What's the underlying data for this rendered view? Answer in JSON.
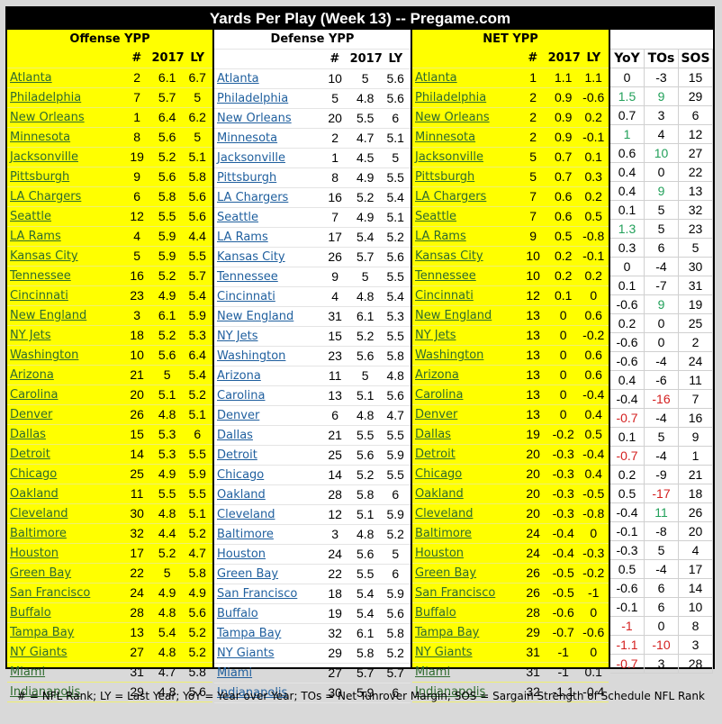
{
  "title": "Yards Per Play (Week 13) -- Pregame.com",
  "sections": {
    "offense": {
      "title": "Offense YPP",
      "cols": [
        "#",
        "2017",
        "LY"
      ]
    },
    "defense": {
      "title": "Defense YPP",
      "cols": [
        "#",
        "2017",
        "LY"
      ]
    },
    "net": {
      "title": "NET YPP",
      "cols": [
        "#",
        "2017",
        "LY"
      ]
    },
    "extra": {
      "cols": [
        "YoY",
        "TOs",
        "SOS"
      ]
    }
  },
  "colors": {
    "highlight": "#ffff00",
    "positive": "#22a05a",
    "negative": "#d42020"
  },
  "offense": [
    [
      "Atlanta",
      "2",
      "6.1",
      "6.7"
    ],
    [
      "Philadelphia",
      "7",
      "5.7",
      "5"
    ],
    [
      "New Orleans",
      "1",
      "6.4",
      "6.2"
    ],
    [
      "Minnesota",
      "8",
      "5.6",
      "5"
    ],
    [
      "Jacksonville",
      "19",
      "5.2",
      "5.1"
    ],
    [
      "Pittsburgh",
      "9",
      "5.6",
      "5.8"
    ],
    [
      "LA Chargers",
      "6",
      "5.8",
      "5.6"
    ],
    [
      "Seattle",
      "12",
      "5.5",
      "5.6"
    ],
    [
      "LA Rams",
      "4",
      "5.9",
      "4.4"
    ],
    [
      "Kansas City",
      "5",
      "5.9",
      "5.5"
    ],
    [
      "Tennessee",
      "16",
      "5.2",
      "5.7"
    ],
    [
      "Cincinnati",
      "23",
      "4.9",
      "5.4"
    ],
    [
      "New England",
      "3",
      "6.1",
      "5.9"
    ],
    [
      "NY Jets",
      "18",
      "5.2",
      "5.3"
    ],
    [
      "Washington",
      "10",
      "5.6",
      "6.4"
    ],
    [
      "Arizona",
      "21",
      "5",
      "5.4"
    ],
    [
      "Carolina",
      "20",
      "5.1",
      "5.2"
    ],
    [
      "Denver",
      "26",
      "4.8",
      "5.1"
    ],
    [
      "Dallas",
      "15",
      "5.3",
      "6"
    ],
    [
      "Detroit",
      "14",
      "5.3",
      "5.5"
    ],
    [
      "Chicago",
      "25",
      "4.9",
      "5.9"
    ],
    [
      "Oakland",
      "11",
      "5.5",
      "5.5"
    ],
    [
      "Cleveland",
      "30",
      "4.8",
      "5.1"
    ],
    [
      "Baltimore",
      "32",
      "4.4",
      "5.2"
    ],
    [
      "Houston",
      "17",
      "5.2",
      "4.7"
    ],
    [
      "Green Bay",
      "22",
      "5",
      "5.8"
    ],
    [
      "San Francisco",
      "24",
      "4.9",
      "4.9"
    ],
    [
      "Buffalo",
      "28",
      "4.8",
      "5.6"
    ],
    [
      "Tampa Bay",
      "13",
      "5.4",
      "5.2"
    ],
    [
      "NY Giants",
      "27",
      "4.8",
      "5.2"
    ],
    [
      "Miami",
      "31",
      "4.7",
      "5.8"
    ],
    [
      "Indianapolis",
      "29",
      "4.8",
      "5.6"
    ]
  ],
  "defense": [
    [
      "Atlanta",
      "10",
      "5",
      "5.6"
    ],
    [
      "Philadelphia",
      "5",
      "4.8",
      "5.6"
    ],
    [
      "New Orleans",
      "20",
      "5.5",
      "6"
    ],
    [
      "Minnesota",
      "2",
      "4.7",
      "5.1"
    ],
    [
      "Jacksonville",
      "1",
      "4.5",
      "5"
    ],
    [
      "Pittsburgh",
      "8",
      "4.9",
      "5.5"
    ],
    [
      "LA Chargers",
      "16",
      "5.2",
      "5.4"
    ],
    [
      "Seattle",
      "7",
      "4.9",
      "5.1"
    ],
    [
      "LA Rams",
      "17",
      "5.4",
      "5.2"
    ],
    [
      "Kansas City",
      "26",
      "5.7",
      "5.6"
    ],
    [
      "Tennessee",
      "9",
      "5",
      "5.5"
    ],
    [
      "Cincinnati",
      "4",
      "4.8",
      "5.4"
    ],
    [
      "New England",
      "31",
      "6.1",
      "5.3"
    ],
    [
      "NY Jets",
      "15",
      "5.2",
      "5.5"
    ],
    [
      "Washington",
      "23",
      "5.6",
      "5.8"
    ],
    [
      "Arizona",
      "11",
      "5",
      "4.8"
    ],
    [
      "Carolina",
      "13",
      "5.1",
      "5.6"
    ],
    [
      "Denver",
      "6",
      "4.8",
      "4.7"
    ],
    [
      "Dallas",
      "21",
      "5.5",
      "5.5"
    ],
    [
      "Detroit",
      "25",
      "5.6",
      "5.9"
    ],
    [
      "Chicago",
      "14",
      "5.2",
      "5.5"
    ],
    [
      "Oakland",
      "28",
      "5.8",
      "6"
    ],
    [
      "Cleveland",
      "12",
      "5.1",
      "5.9"
    ],
    [
      "Baltimore",
      "3",
      "4.8",
      "5.2"
    ],
    [
      "Houston",
      "24",
      "5.6",
      "5"
    ],
    [
      "Green Bay",
      "22",
      "5.5",
      "6"
    ],
    [
      "San Francisco",
      "18",
      "5.4",
      "5.9"
    ],
    [
      "Buffalo",
      "19",
      "5.4",
      "5.6"
    ],
    [
      "Tampa Bay",
      "32",
      "6.1",
      "5.8"
    ],
    [
      "NY Giants",
      "29",
      "5.8",
      "5.2"
    ],
    [
      "Miami",
      "27",
      "5.7",
      "5.7"
    ],
    [
      "Indianapolis",
      "30",
      "5.9",
      "6"
    ]
  ],
  "net": [
    [
      "Atlanta",
      "1",
      "1.1",
      "1.1"
    ],
    [
      "Philadelphia",
      "2",
      "0.9",
      "-0.6"
    ],
    [
      "New Orleans",
      "2",
      "0.9",
      "0.2"
    ],
    [
      "Minnesota",
      "2",
      "0.9",
      "-0.1"
    ],
    [
      "Jacksonville",
      "5",
      "0.7",
      "0.1"
    ],
    [
      "Pittsburgh",
      "5",
      "0.7",
      "0.3"
    ],
    [
      "LA Chargers",
      "7",
      "0.6",
      "0.2"
    ],
    [
      "Seattle",
      "7",
      "0.6",
      "0.5"
    ],
    [
      "LA Rams",
      "9",
      "0.5",
      "-0.8"
    ],
    [
      "Kansas City",
      "10",
      "0.2",
      "-0.1"
    ],
    [
      "Tennessee",
      "10",
      "0.2",
      "0.2"
    ],
    [
      "Cincinnati",
      "12",
      "0.1",
      "0"
    ],
    [
      "New England",
      "13",
      "0",
      "0.6"
    ],
    [
      "NY Jets",
      "13",
      "0",
      "-0.2"
    ],
    [
      "Washington",
      "13",
      "0",
      "0.6"
    ],
    [
      "Arizona",
      "13",
      "0",
      "0.6"
    ],
    [
      "Carolina",
      "13",
      "0",
      "-0.4"
    ],
    [
      "Denver",
      "13",
      "0",
      "0.4"
    ],
    [
      "Dallas",
      "19",
      "-0.2",
      "0.5"
    ],
    [
      "Detroit",
      "20",
      "-0.3",
      "-0.4"
    ],
    [
      "Chicago",
      "20",
      "-0.3",
      "0.4"
    ],
    [
      "Oakland",
      "20",
      "-0.3",
      "-0.5"
    ],
    [
      "Cleveland",
      "20",
      "-0.3",
      "-0.8"
    ],
    [
      "Baltimore",
      "24",
      "-0.4",
      "0"
    ],
    [
      "Houston",
      "24",
      "-0.4",
      "-0.3"
    ],
    [
      "Green Bay",
      "26",
      "-0.5",
      "-0.2"
    ],
    [
      "San Francisco",
      "26",
      "-0.5",
      "-1"
    ],
    [
      "Buffalo",
      "28",
      "-0.6",
      "0"
    ],
    [
      "Tampa Bay",
      "29",
      "-0.7",
      "-0.6"
    ],
    [
      "NY Giants",
      "31",
      "-1",
      "0"
    ],
    [
      "Miami",
      "31",
      "-1",
      "0.1"
    ],
    [
      "Indianapolis",
      "32",
      "-1.1",
      "-0.4"
    ]
  ],
  "extra": [
    [
      [
        "0",
        ""
      ],
      [
        "-3",
        ""
      ],
      [
        "15",
        ""
      ]
    ],
    [
      [
        "1.5",
        "pos"
      ],
      [
        "9",
        "pos"
      ],
      [
        "29",
        ""
      ]
    ],
    [
      [
        "0.7",
        ""
      ],
      [
        "3",
        ""
      ],
      [
        "6",
        ""
      ]
    ],
    [
      [
        "1",
        "pos"
      ],
      [
        "4",
        ""
      ],
      [
        "12",
        ""
      ]
    ],
    [
      [
        "0.6",
        ""
      ],
      [
        "10",
        "pos"
      ],
      [
        "27",
        ""
      ]
    ],
    [
      [
        "0.4",
        ""
      ],
      [
        "0",
        ""
      ],
      [
        "22",
        ""
      ]
    ],
    [
      [
        "0.4",
        ""
      ],
      [
        "9",
        "pos"
      ],
      [
        "13",
        ""
      ]
    ],
    [
      [
        "0.1",
        ""
      ],
      [
        "5",
        ""
      ],
      [
        "32",
        ""
      ]
    ],
    [
      [
        "1.3",
        "pos"
      ],
      [
        "5",
        ""
      ],
      [
        "23",
        ""
      ]
    ],
    [
      [
        "0.3",
        ""
      ],
      [
        "6",
        ""
      ],
      [
        "5",
        ""
      ]
    ],
    [
      [
        "0",
        ""
      ],
      [
        "-4",
        ""
      ],
      [
        "30",
        ""
      ]
    ],
    [
      [
        "0.1",
        ""
      ],
      [
        "-7",
        ""
      ],
      [
        "31",
        ""
      ]
    ],
    [
      [
        "-0.6",
        ""
      ],
      [
        "9",
        "pos"
      ],
      [
        "19",
        ""
      ]
    ],
    [
      [
        "0.2",
        ""
      ],
      [
        "0",
        ""
      ],
      [
        "25",
        ""
      ]
    ],
    [
      [
        "-0.6",
        ""
      ],
      [
        "0",
        ""
      ],
      [
        "2",
        ""
      ]
    ],
    [
      [
        "-0.6",
        ""
      ],
      [
        "-4",
        ""
      ],
      [
        "24",
        ""
      ]
    ],
    [
      [
        "0.4",
        ""
      ],
      [
        "-6",
        ""
      ],
      [
        "11",
        ""
      ]
    ],
    [
      [
        "-0.4",
        ""
      ],
      [
        "-16",
        "neg"
      ],
      [
        "7",
        ""
      ]
    ],
    [
      [
        "-0.7",
        "neg"
      ],
      [
        "-4",
        ""
      ],
      [
        "16",
        ""
      ]
    ],
    [
      [
        "0.1",
        ""
      ],
      [
        "5",
        ""
      ],
      [
        "9",
        ""
      ]
    ],
    [
      [
        "-0.7",
        "neg"
      ],
      [
        "-4",
        ""
      ],
      [
        "1",
        ""
      ]
    ],
    [
      [
        "0.2",
        ""
      ],
      [
        "-9",
        ""
      ],
      [
        "21",
        ""
      ]
    ],
    [
      [
        "0.5",
        ""
      ],
      [
        "-17",
        "neg"
      ],
      [
        "18",
        ""
      ]
    ],
    [
      [
        "-0.4",
        ""
      ],
      [
        "11",
        "pos"
      ],
      [
        "26",
        ""
      ]
    ],
    [
      [
        "-0.1",
        ""
      ],
      [
        "-8",
        ""
      ],
      [
        "20",
        ""
      ]
    ],
    [
      [
        "-0.3",
        ""
      ],
      [
        "5",
        ""
      ],
      [
        "4",
        ""
      ]
    ],
    [
      [
        "0.5",
        ""
      ],
      [
        "-4",
        ""
      ],
      [
        "17",
        ""
      ]
    ],
    [
      [
        "-0.6",
        ""
      ],
      [
        "6",
        ""
      ],
      [
        "14",
        ""
      ]
    ],
    [
      [
        "-0.1",
        ""
      ],
      [
        "6",
        ""
      ],
      [
        "10",
        ""
      ]
    ],
    [
      [
        "-1",
        "neg"
      ],
      [
        "0",
        ""
      ],
      [
        "8",
        ""
      ]
    ],
    [
      [
        "-1.1",
        "neg"
      ],
      [
        "-10",
        "neg"
      ],
      [
        "3",
        ""
      ]
    ],
    [
      [
        "-0.7",
        "neg"
      ],
      [
        "3",
        ""
      ],
      [
        "28",
        ""
      ]
    ]
  ],
  "footer": "# = NFL Rank; LY = Last Year; YoY = Year over Year; TOs = Net Tunrover Margin; SOS = Sargain Strength of Schedule NFL Rank"
}
